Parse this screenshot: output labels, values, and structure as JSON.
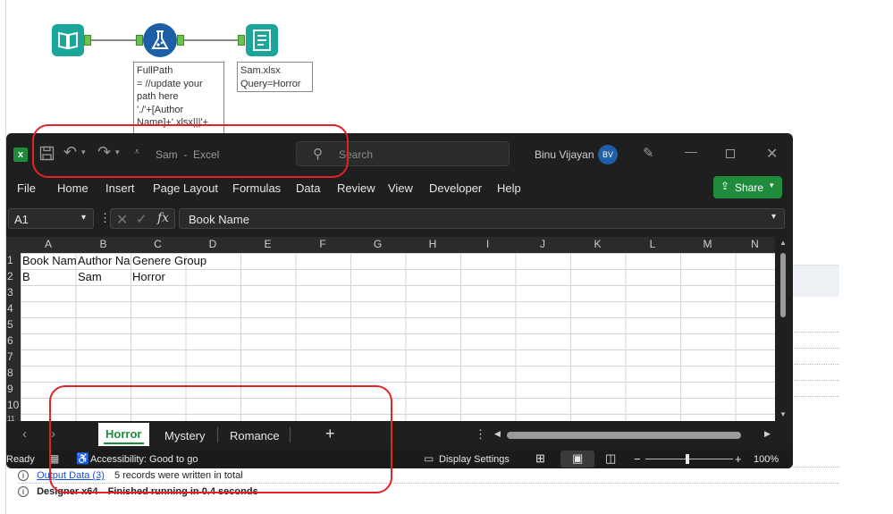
{
  "workflow": {
    "input_tool_icon": "book-input-icon",
    "formula_tool_icon": "formula-flask-icon",
    "output_tool_icon": "output-document-icon",
    "formula_annotation": [
      "FullPath",
      "= //update your",
      "path here",
      "'./'+[Author",
      "Name]+'.xlsx|||'+"
    ],
    "output_annotation": [
      "Sam.xlsx",
      "Query=Horror"
    ]
  },
  "results": {
    "row1_link": "Output Data (3)",
    "row1_text": "5 records were written in total",
    "row2_source": "Designer x64",
    "row2_text": "Finished running in 0.4 seconds"
  },
  "excel": {
    "app_icon": "excel-icon",
    "title": "Sam  -  Excel",
    "search_placeholder": "Search",
    "user_name": "Binu Vijayan",
    "user_initials": "BV",
    "menu": [
      "File",
      "Home",
      "Insert",
      "Page Layout",
      "Formulas",
      "Data",
      "Review",
      "View",
      "Developer",
      "Help"
    ],
    "share_label": "Share",
    "name_box": "A1",
    "formula_value": "Book Name",
    "columns": [
      "A",
      "B",
      "C",
      "D",
      "E",
      "F",
      "G",
      "H",
      "I",
      "J",
      "K",
      "L",
      "M",
      "N"
    ],
    "rows": [
      "1",
      "2",
      "3",
      "4",
      "5",
      "6",
      "7",
      "8",
      "9",
      "10",
      "11"
    ],
    "cells": {
      "a1": "Book Name",
      "b1": "Author Name",
      "c1": "Genere Group",
      "a2": "B",
      "b2": "Sam",
      "c2": "Horror"
    },
    "sheets": [
      "Horror",
      "Mystery",
      "Romance"
    ],
    "active_sheet": "Horror",
    "status_ready": "Ready",
    "accessibility": "Accessibility: Good to go",
    "display_settings": "Display Settings",
    "zoom": "100%",
    "accent": "#1e8c3a",
    "avatar_color": "#1f5fa8"
  },
  "annotation_color": "#e32228"
}
